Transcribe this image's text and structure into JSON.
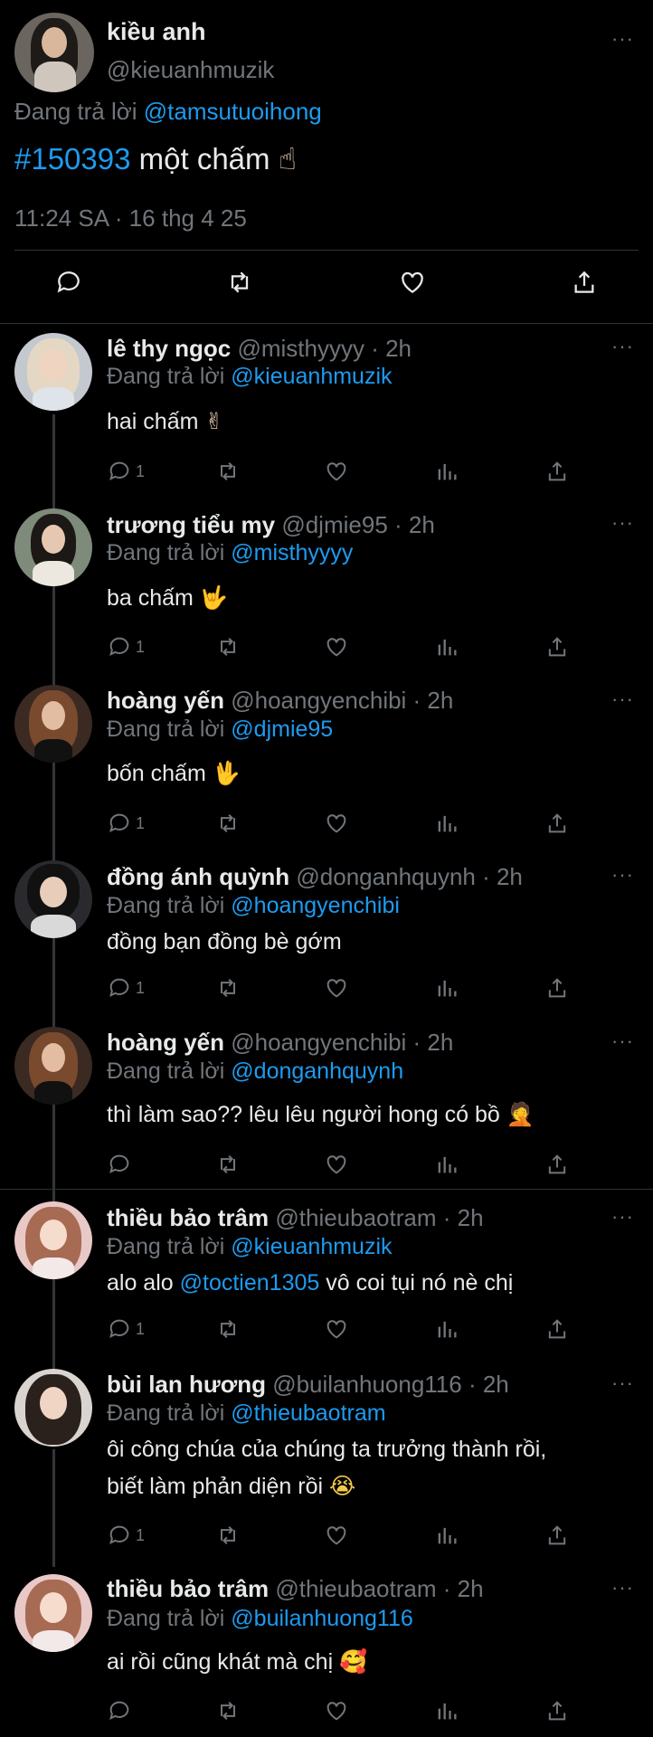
{
  "main_tweet": {
    "name": "kiều anh",
    "handle": "@kieuanhmuzik",
    "reply_prefix": "Đang trả lời ",
    "reply_to": "@tamsutuoihong",
    "hashtag": "#150393",
    "text": " một chấm ",
    "emoji": "☝",
    "timestamp": "11:24 SA · 16 thg 4 25"
  },
  "more_icon": "···",
  "replies": [
    {
      "name": "lê thy ngọc",
      "meta": " @misthyyyy · 2h",
      "reply_prefix": "Đang trả lời ",
      "reply_to": "@kieuanhmuzik",
      "text": "hai chấm ",
      "emoji": "✌",
      "reply_count": "1"
    },
    {
      "name": "trương tiểu my",
      "meta": " @djmie95 · 2h",
      "reply_prefix": "Đang trả lời ",
      "reply_to": "@misthyyyy",
      "text": "ba chấm ",
      "emoji": "🤟",
      "reply_count": "1"
    },
    {
      "name": "hoàng yến",
      "meta": " @hoangyenchibi · 2h",
      "reply_prefix": "Đang trả lời ",
      "reply_to": "@djmie95",
      "text": "bốn chấm ",
      "emoji": "🖖",
      "reply_count": "1"
    },
    {
      "name": "đồng ánh quỳnh",
      "meta": " @donganhquynh · 2h",
      "reply_prefix": "Đang trả lời ",
      "reply_to": "@hoangyenchibi",
      "text": "đồng bạn đồng bè gớm",
      "emoji": "",
      "reply_count": "1"
    },
    {
      "name": "hoàng yến",
      "meta": " @hoangyenchibi · 2h",
      "reply_prefix": "Đang trả lời ",
      "reply_to": "@donganhquynh",
      "text": "thì làm sao?? lêu lêu người hong có bồ ",
      "emoji": "🤦",
      "reply_count": ""
    },
    {
      "name": "thiều bảo trâm",
      "meta": " @thieubaotram · 2h",
      "reply_prefix": "Đang trả lời ",
      "reply_to": "@kieuanhmuzik",
      "text_pre": "alo alo ",
      "mention": "@toctien1305",
      "text_post": " vô coi tụi nó nè chị",
      "reply_count": "1"
    },
    {
      "name": "bùi lan hương",
      "meta": " @builanhuong116 · 2h",
      "reply_prefix": "Đang trả lời ",
      "reply_to": "@thieubaotram",
      "line1": "ôi công chúa của chúng ta trưởng thành rồi,",
      "line2": "biết làm phản diện rồi ",
      "emoji": "😭",
      "reply_count": "1"
    },
    {
      "name": "thiều bảo trâm",
      "meta": " @thieubaotram · 2h",
      "reply_prefix": "Đang trả lời ",
      "reply_to": "@builanhuong116",
      "text": "ai rồi cũng khát mà chị ",
      "emoji": "🥰",
      "reply_count": ""
    }
  ],
  "colors": {
    "background": "#000000",
    "text": "#e7e9ea",
    "secondary": "#71767b",
    "accent": "#1d9bf0",
    "divider": "#2f3336"
  }
}
